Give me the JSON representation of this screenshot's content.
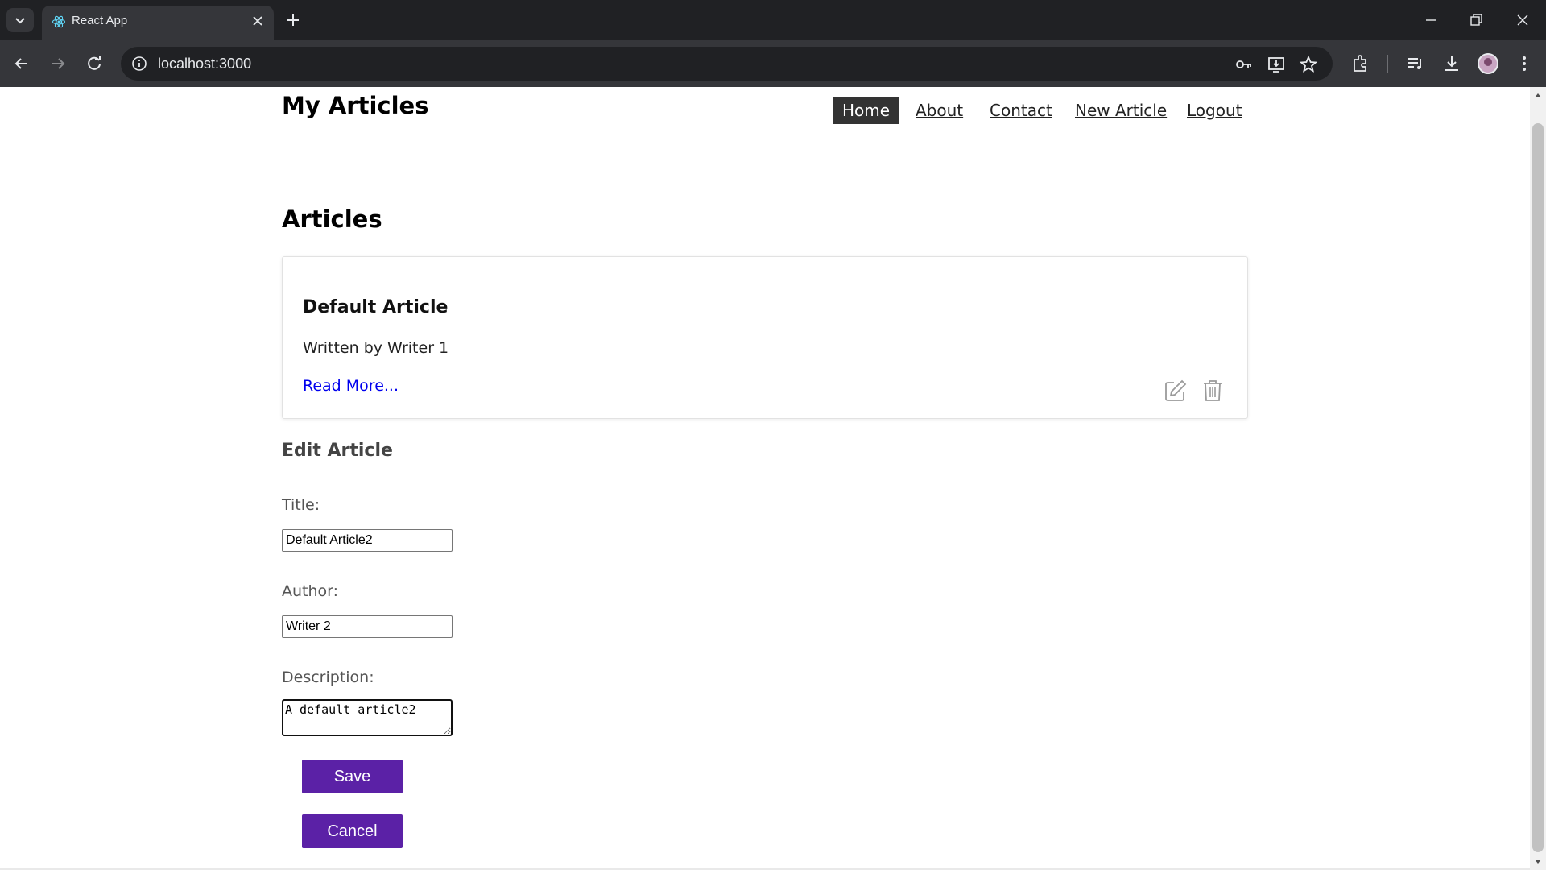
{
  "browser": {
    "tab_title": "React App",
    "url": "localhost:3000"
  },
  "site": {
    "title": "My Articles",
    "nav": [
      "Home",
      "About",
      "Contact",
      "New Article",
      "Logout"
    ],
    "active_nav": "Home"
  },
  "articles": {
    "heading": "Articles",
    "items": [
      {
        "title": "Default Article",
        "author_line": "Written by Writer 1",
        "read_more": "Read More..."
      }
    ]
  },
  "edit_form": {
    "heading": "Edit Article",
    "title_label": "Title:",
    "title_value": "Default Article2",
    "author_label": "Author:",
    "author_value": "Writer 2",
    "description_label": "Description:",
    "description_value": "A default article2",
    "save_label": "Save",
    "cancel_label": "Cancel"
  },
  "colors": {
    "button_bg": "#5b21a6",
    "nav_active_bg": "#333333",
    "link": "#0000ee"
  },
  "icons": [
    "tab-search-icon",
    "react-icon",
    "close-icon",
    "plus-icon",
    "minimize-icon",
    "restore-icon",
    "window-close-icon",
    "back-icon",
    "forward-icon",
    "reload-icon",
    "info-icon",
    "key-icon",
    "install-icon",
    "star-icon",
    "extensions-icon",
    "media-icon",
    "download-icon",
    "menu-icon",
    "edit-icon",
    "trash-icon"
  ]
}
